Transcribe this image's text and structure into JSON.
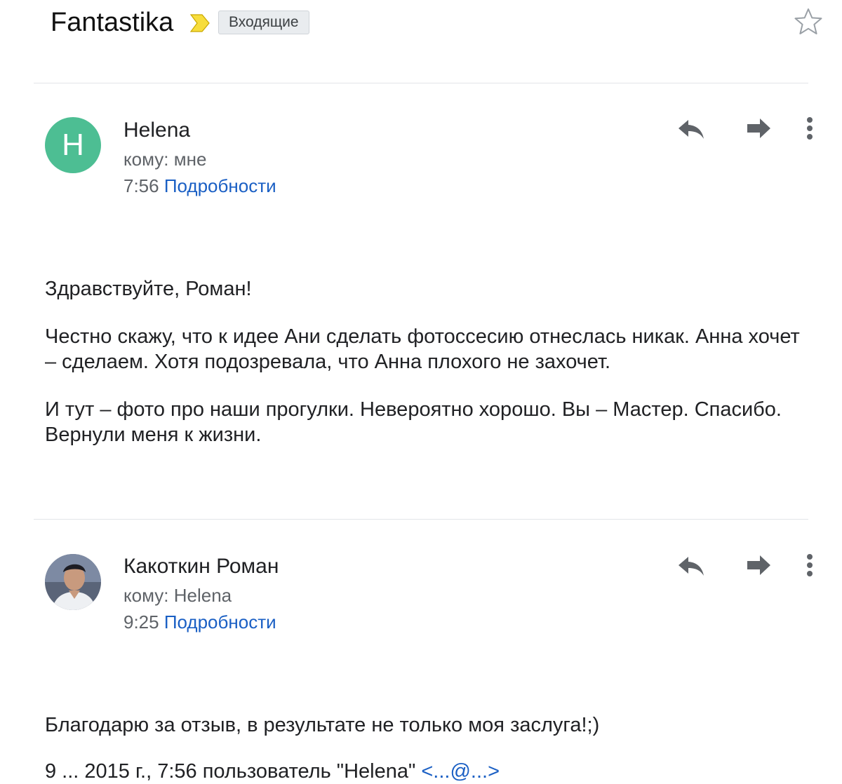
{
  "thread": {
    "subject": "Fantastika",
    "label": "Входящие",
    "importance_color": "#f7dd3c",
    "star_icon": "star-outline-icon"
  },
  "messages": [
    {
      "avatar_letter": "H",
      "avatar_color": "#4dbe93",
      "sender": "Helena",
      "to": "кому: мне",
      "time": "7:56",
      "details_label": "Подробности",
      "body": [
        "Здравствуйте, Роман!",
        "Честно скажу, что к идее Ани сделать фотоссесию отнеслась никак. Анна хочет – сделаем. Хотя подозревала, что Анна плохого не захочет.",
        "И тут – фото про наши прогулки. Невероятно хорошо. Вы – Мастер. Спасибо. Вернули меня к жизни."
      ]
    },
    {
      "avatar": "profile-photo",
      "sender": "Какоткин Роман",
      "to": "кому: Helena",
      "time": "9:25",
      "details_label": "Подробности",
      "body": [
        "Благодарю за отзыв, в результате не только моя заслуга!;)"
      ],
      "quote_partial": "9 ... 2015 г., 7:56 пользователь \"Helena\"",
      "quote_partial_email": "<...@...>"
    }
  ],
  "icons": {
    "reply": "reply-icon",
    "forward": "forward-icon",
    "more": "more-vert-icon"
  }
}
